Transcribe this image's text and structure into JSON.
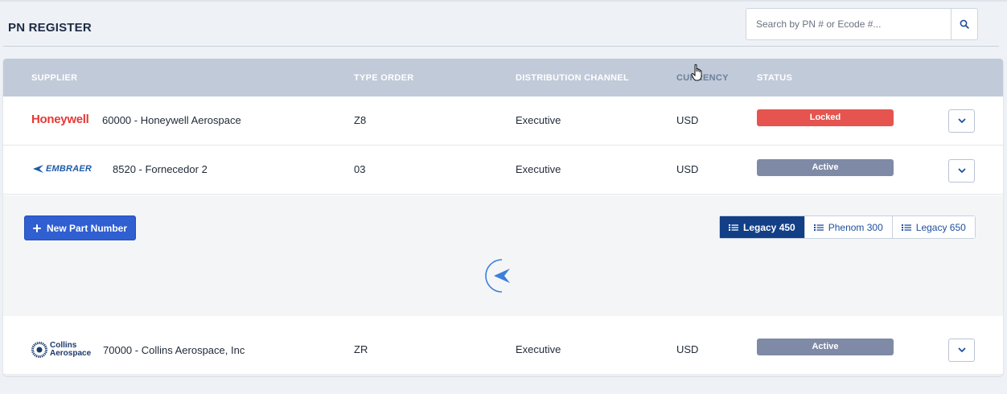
{
  "header": {
    "title": "PN REGISTER",
    "search_placeholder": "Search by PN # or Ecode #..."
  },
  "table": {
    "columns": {
      "supplier": "SUPPLIER",
      "type_order": "TYPE ORDER",
      "distribution_channel": "DISTRIBUTION CHANNEL",
      "currency": "CURRENCY",
      "status": "STATUS"
    },
    "rows": [
      {
        "logo_text": "Honeywell",
        "supplier": "60000 - Honeywell Aerospace",
        "type_order": "Z8",
        "distribution_channel": "Executive",
        "currency": "USD",
        "status": "Locked"
      },
      {
        "logo_text": "EMBRAER",
        "supplier": "8520 - Fornecedor 2",
        "type_order": "03",
        "distribution_channel": "Executive",
        "currency": "USD",
        "status": "Active"
      },
      {
        "logo_text_1": "Collins",
        "logo_text_2": "Aerospace",
        "supplier": "70000 - Collins Aerospace, Inc",
        "type_order": "ZR",
        "distribution_channel": "Executive",
        "currency": "USD",
        "status": "Active"
      }
    ]
  },
  "expanded_panel": {
    "new_button": "New Part Number",
    "tabs": [
      "Legacy 450",
      "Phenom 300",
      "Legacy 650"
    ],
    "active_tab": "Legacy 450"
  },
  "colors": {
    "locked": "#e5544f",
    "active": "#7f8aa6",
    "primary": "#2f5fd0",
    "tab_active": "#123f86"
  },
  "icons": [
    "search-icon",
    "chevron-down-icon",
    "plus-icon",
    "list-icon",
    "loading-spinner-icon",
    "hand-cursor-icon"
  ]
}
